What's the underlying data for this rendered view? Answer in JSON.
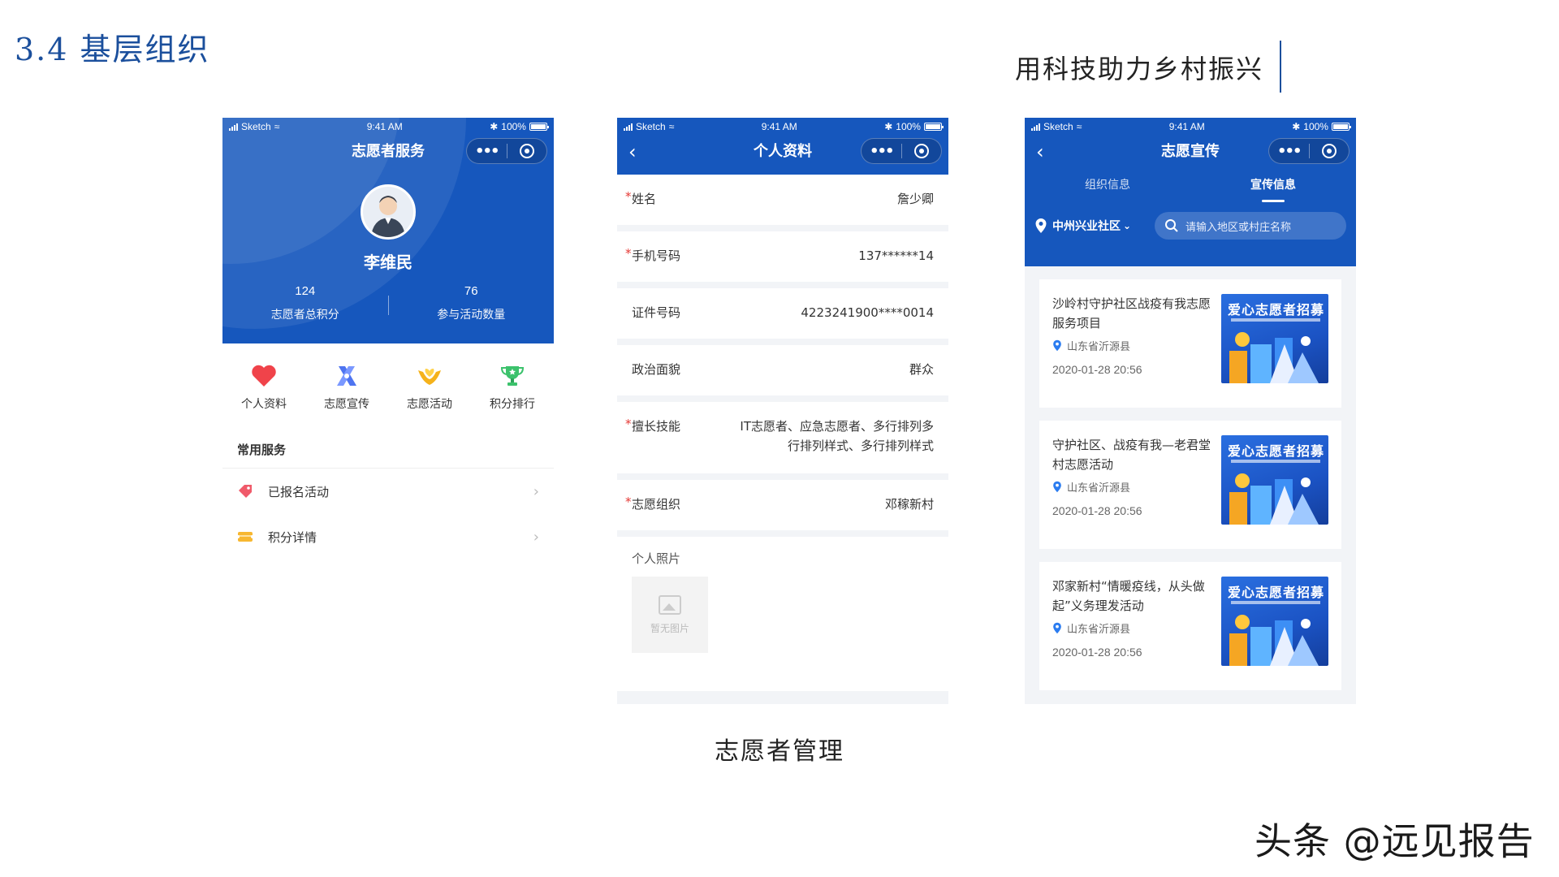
{
  "slide": {
    "title": "3.4 基层组织",
    "subtitle": "用科技助力乡村振兴",
    "caption": "志愿者管理",
    "watermark": "头条 @远见报告"
  },
  "status_bar": {
    "carrier": "Sketch",
    "time": "9:41 AM",
    "battery": "100%"
  },
  "phone1": {
    "nav_title": "志愿者服务",
    "user_name": "李维民",
    "stats": [
      {
        "value": "124",
        "label": "志愿者总积分"
      },
      {
        "value": "76",
        "label": "参与活动数量"
      }
    ],
    "quick_actions": [
      {
        "label": "个人资料",
        "icon": "heart-icon"
      },
      {
        "label": "志愿宣传",
        "icon": "ribbon-icon"
      },
      {
        "label": "志愿活动",
        "icon": "helping-hands-icon"
      },
      {
        "label": "积分排行",
        "icon": "trophy-icon"
      }
    ],
    "section_title": "常用服务",
    "menu": [
      {
        "label": "已报名活动",
        "icon": "tag-icon"
      },
      {
        "label": "积分详情",
        "icon": "ticket-icon"
      }
    ]
  },
  "phone2": {
    "nav_title": "个人资料",
    "fields": [
      {
        "required": "*",
        "label": "姓名",
        "value": "詹少卿"
      },
      {
        "required": "*",
        "label": "手机号码",
        "value": "137******14"
      },
      {
        "required": "",
        "label": "证件号码",
        "value": "4223241900****0014"
      },
      {
        "required": "",
        "label": "政治面貌",
        "value": "群众"
      },
      {
        "required": "*",
        "label": "擅长技能",
        "value": "IT志愿者、应急志愿者、多行排列多行排列样式、多行排列样式"
      },
      {
        "required": "*",
        "label": "志愿组织",
        "value": "邓稼新村"
      }
    ],
    "photo_label": "个人照片",
    "photo_placeholder": "暂无图片"
  },
  "phone3": {
    "nav_title": "志愿宣传",
    "tabs": [
      {
        "label": "组织信息",
        "active": false
      },
      {
        "label": "宣传信息",
        "active": true
      }
    ],
    "region": "中州兴业社区",
    "search_placeholder": "请输入地区或村庄名称",
    "thumb_title": "爱心志愿者招募",
    "news": [
      {
        "title": "沙岭村守护社区战疫有我志愿服务项目",
        "location": "山东省沂源县",
        "time": "2020-01-28 20:56"
      },
      {
        "title": "守护社区、战疫有我—老君堂村志愿活动",
        "location": "山东省沂源县",
        "time": "2020-01-28 20:56"
      },
      {
        "title": "邓家新村“情暖疫线，从头做起”义务理发活动",
        "location": "山东省沂源县",
        "time": "2020-01-28 20:56"
      }
    ]
  },
  "colors": {
    "brand_blue": "#1657bd",
    "title_blue": "#1b4f9c",
    "required_red": "#e53935"
  }
}
